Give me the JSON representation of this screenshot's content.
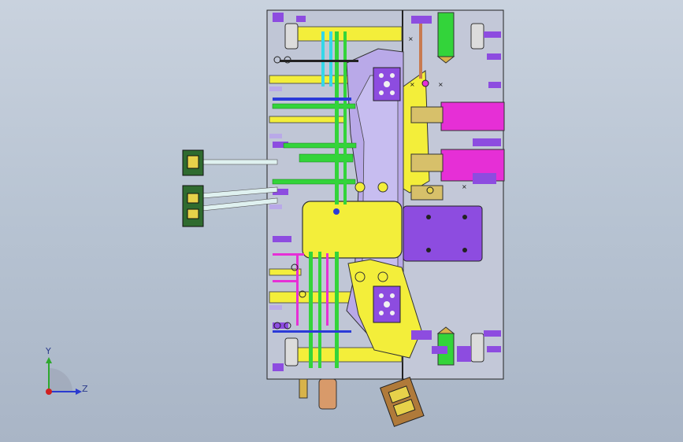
{
  "window": {
    "background_top": "#c9d2de",
    "background_bottom": "#a9b5c6"
  },
  "triad": {
    "y_label": "Y",
    "z_label": "Z",
    "y_color": "#2ea82e",
    "z_color": "#2a3ad0",
    "x_color": "#d02020"
  },
  "palette": {
    "plate_outline": "#2a2a2a",
    "yellow": "#f3ee3a",
    "purple": "#8d4ce0",
    "green": "#33d43a",
    "magenta": "#e62fd6",
    "cyan": "#35d7e8",
    "blue": "#2b3ad8",
    "lavender": "#b9a9e8",
    "brass": "#d8b34a",
    "grey": "#d8d8d8"
  }
}
